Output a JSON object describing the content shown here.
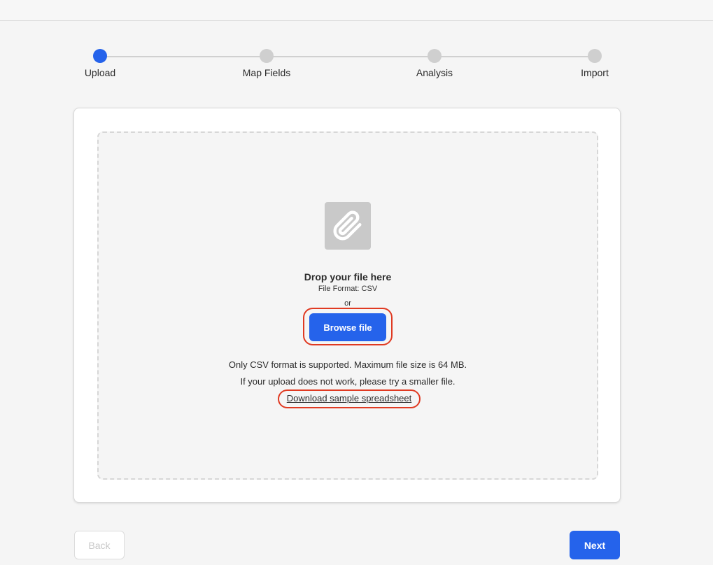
{
  "stepper": {
    "steps": [
      {
        "label": "Upload",
        "active": true
      },
      {
        "label": "Map Fields",
        "active": false
      },
      {
        "label": "Analysis",
        "active": false
      },
      {
        "label": "Import",
        "active": false
      }
    ]
  },
  "dropzone": {
    "icon": "paperclip-icon",
    "title": "Drop your file here",
    "file_format": "File Format: CSV",
    "or": "or",
    "browse_label": "Browse file",
    "info_line1": "Only CSV format is supported. Maximum file size is 64 MB.",
    "info_line2": "If your upload does not work, please try a smaller file.",
    "download_label": "Download sample spreadsheet"
  },
  "footer": {
    "back_label": "Back",
    "next_label": "Next"
  },
  "colors": {
    "accent": "#2563eb",
    "highlight": "#e03a22"
  }
}
